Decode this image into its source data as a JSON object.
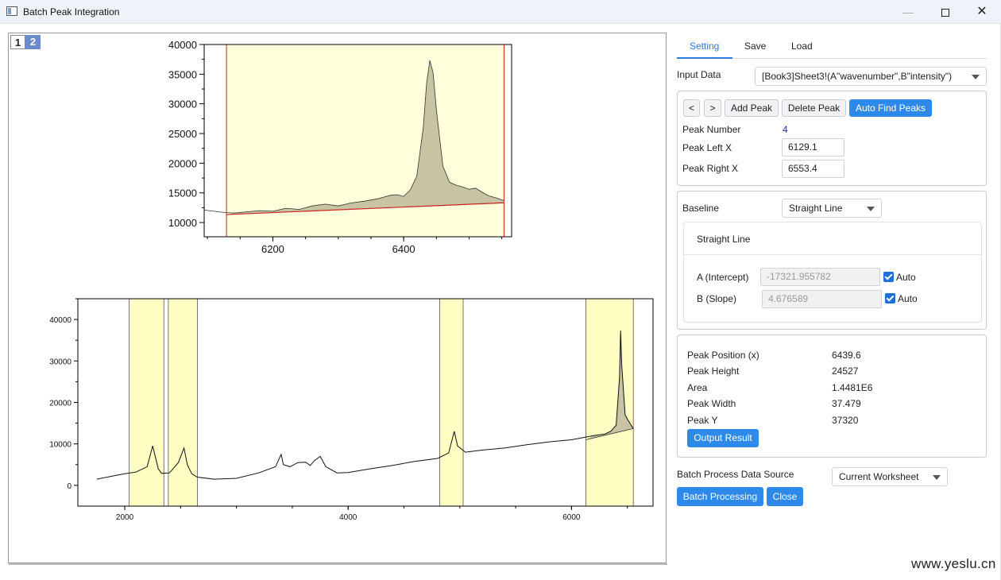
{
  "window": {
    "title": "Batch Peak Integration",
    "minimize_icon": "minimize-icon",
    "maximize_icon": "maximize-icon",
    "close_icon": "close-icon"
  },
  "graph": {
    "layer_tabs": [
      "1",
      "2"
    ],
    "top_plot": {
      "y_ticks": [
        "40000",
        "35000",
        "30000",
        "25000",
        "20000",
        "15000",
        "10000"
      ],
      "x_ticks": [
        "6200",
        "6400"
      ]
    },
    "bottom_plot": {
      "y_ticks": [
        "40000",
        "30000",
        "20000",
        "10000",
        "0"
      ],
      "x_ticks": [
        "2000",
        "4000",
        "6000"
      ]
    }
  },
  "chart_data": [
    {
      "type": "line",
      "title": "",
      "xlabel": "",
      "ylabel": "",
      "xlim": [
        6095,
        6565
      ],
      "ylim": [
        7600,
        40000
      ],
      "grid": false,
      "integration_region": [
        6129.1,
        6553.4
      ],
      "baseline": {
        "intercept": -17321.955782,
        "slope": 4.676589
      },
      "series": [
        {
          "x": [
            6095,
            6110,
            6125,
            6140,
            6160,
            6180,
            6200,
            6220,
            6240,
            6260,
            6280,
            6300,
            6320,
            6340,
            6360,
            6370,
            6380,
            6390,
            6400,
            6410,
            6420,
            6430,
            6435,
            6440,
            6445,
            6450,
            6460,
            6470,
            6480,
            6490,
            6500,
            6510,
            6520,
            6530,
            6540,
            6553
          ],
          "y": [
            12100,
            11900,
            11700,
            11600,
            11800,
            12000,
            11900,
            12400,
            12200,
            12800,
            13100,
            12800,
            13300,
            13600,
            14000,
            14300,
            14600,
            14700,
            14400,
            15500,
            17800,
            26000,
            33500,
            37320,
            35200,
            29000,
            19500,
            16800,
            16300,
            16000,
            15600,
            15800,
            15100,
            14500,
            14200,
            13700
          ]
        }
      ]
    },
    {
      "type": "line",
      "title": "",
      "xlabel": "",
      "ylabel": "",
      "xlim": [
        1580,
        6730
      ],
      "ylim": [
        -5000,
        45000
      ],
      "grid": false,
      "peak_regions": [
        [
          2040,
          2350
        ],
        [
          2390,
          2650
        ],
        [
          4820,
          5030
        ],
        [
          6129.1,
          6553.4
        ]
      ],
      "series": [
        {
          "x": [
            1750,
            1900,
            2000,
            2100,
            2200,
            2250,
            2300,
            2330,
            2400,
            2480,
            2530,
            2560,
            2600,
            2650,
            2800,
            3000,
            3200,
            3350,
            3400,
            3420,
            3480,
            3550,
            3620,
            3660,
            3700,
            3750,
            3800,
            3900,
            4000,
            4200,
            4400,
            4600,
            4800,
            4900,
            4950,
            4980,
            5050,
            5200,
            5400,
            5600,
            5800,
            6000,
            6100,
            6200,
            6300,
            6350,
            6400,
            6430,
            6440,
            6450,
            6480,
            6500,
            6553
          ],
          "y": [
            1500,
            2300,
            2800,
            3200,
            4500,
            9500,
            4000,
            2900,
            3000,
            5500,
            9000,
            5000,
            2800,
            2000,
            1500,
            1700,
            3000,
            4500,
            7500,
            5000,
            4500,
            5500,
            5600,
            4800,
            6000,
            7000,
            4500,
            3000,
            3100,
            4000,
            4800,
            5800,
            6500,
            7800,
            13000,
            9500,
            8000,
            8500,
            9000,
            9800,
            10500,
            11000,
            11500,
            12000,
            12400,
            13000,
            14500,
            26000,
            37320,
            29000,
            17000,
            16000,
            13700
          ]
        }
      ]
    }
  ],
  "settings": {
    "tabs": [
      "Setting",
      "Save",
      "Load"
    ],
    "input_data_label": "Input Data",
    "input_data_value": "[Book3]Sheet3!(A\"wavenumber\",B\"intensity\")",
    "prev_label": "<",
    "next_label": ">",
    "add_peak": "Add Peak",
    "delete_peak": "Delete Peak",
    "auto_find": "Auto Find Peaks",
    "peak_number_label": "Peak Number",
    "peak_number": "4",
    "peak_left_label": "Peak Left X",
    "peak_left_value": "6129.1",
    "peak_right_label": "Peak Right X",
    "peak_right_value": "6553.4",
    "baseline_label": "Baseline",
    "baseline_value": "Straight Line",
    "baseline_group_title": "Straight Line",
    "intercept_label": "A (Intercept)",
    "intercept_value": "-17321.955782",
    "slope_label": "B (Slope)",
    "slope_value": "4.676589",
    "auto_label": "Auto",
    "results": {
      "position_label": "Peak Position (x)",
      "position_value": "6439.6",
      "height_label": "Peak Height",
      "height_value": "24527",
      "area_label": "Area",
      "area_value": "1.4481E6",
      "width_label": "Peak Width",
      "width_value": "37.479",
      "y_label": "Peak Y",
      "y_value": "37320",
      "output_button": "Output Result"
    },
    "batch_source_label": "Batch Process Data Source",
    "batch_source_value": "Current Worksheet",
    "batch_button": "Batch Processing",
    "close_button": "Close"
  },
  "watermark": "www.yeslu.cn",
  "colors": {
    "accent": "#2e89ea",
    "region_fill": "#ffffcc",
    "region_edge": "#cc2222",
    "peak_fill": "#c8c3a3",
    "baseline": "#cc2222"
  }
}
